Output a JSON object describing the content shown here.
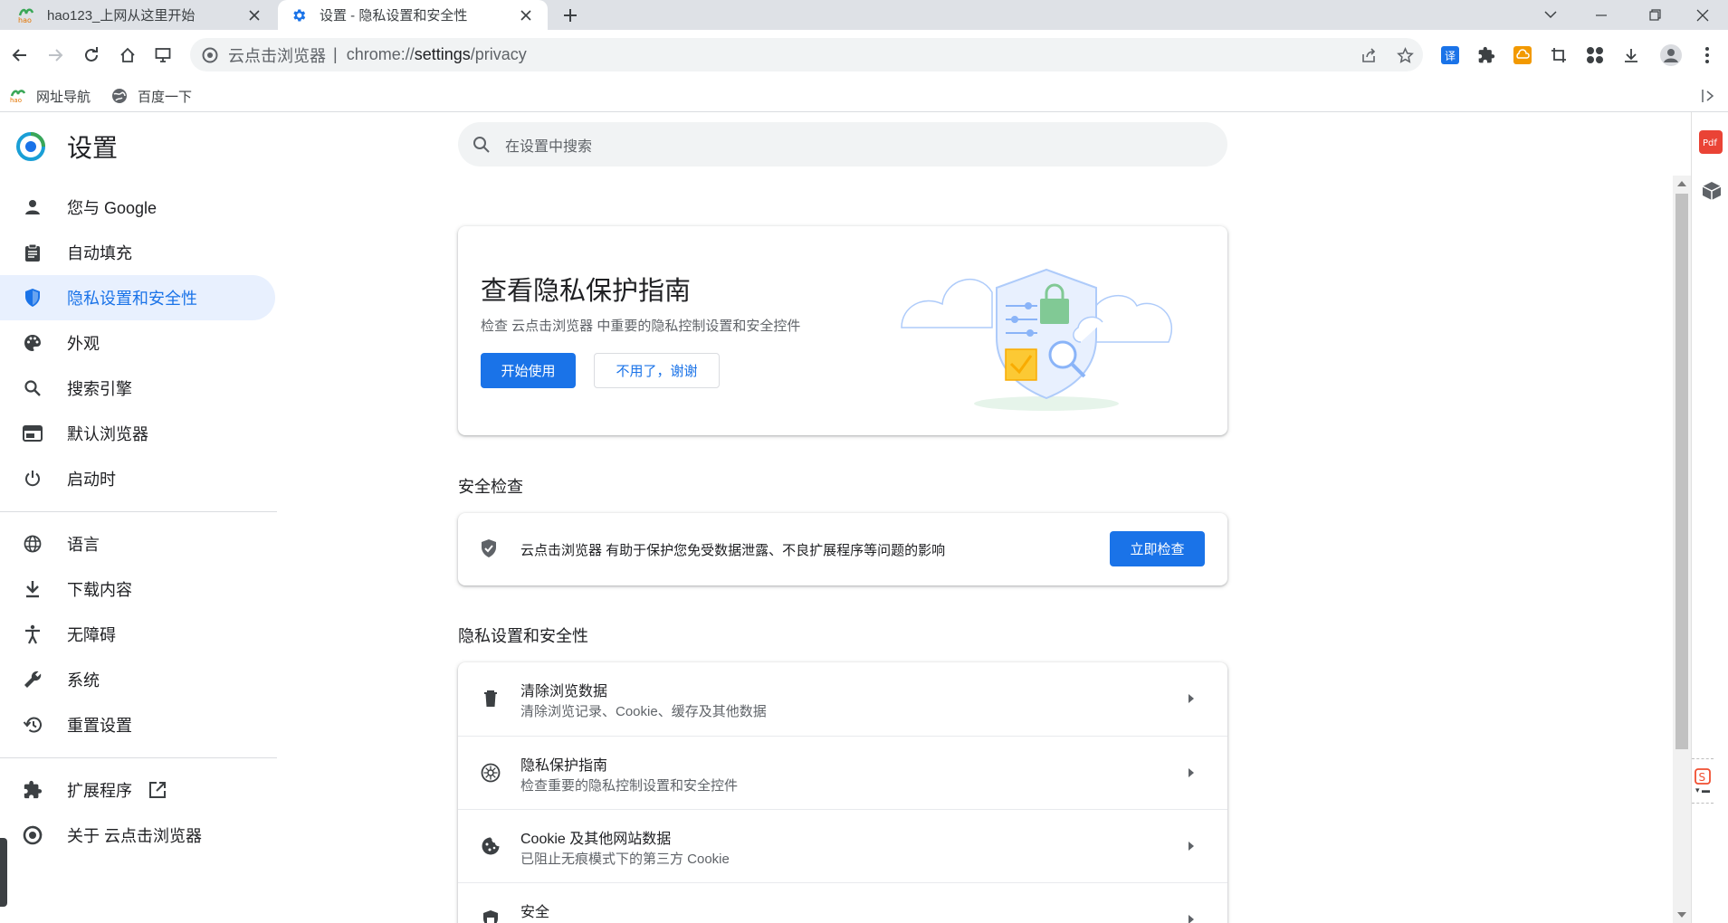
{
  "tabs": [
    {
      "title": "hao123_上网从这里开始",
      "icon": "hao123-icon"
    },
    {
      "title": "设置 - 隐私设置和安全性",
      "icon": "gear-icon"
    }
  ],
  "omnibox": {
    "site": "云点击浏览器",
    "separator": "|",
    "url_scheme": "chrome://",
    "url_host": "settings",
    "url_path": "/privacy"
  },
  "bookmarks": [
    {
      "label": "网址导航",
      "icon": "hao-icon"
    },
    {
      "label": "百度一下",
      "icon": "globe-icon"
    }
  ],
  "settings": {
    "title": "设置",
    "search_placeholder": "在设置中搜索"
  },
  "nav": {
    "items": [
      {
        "label": "您与 Google",
        "icon": "person-icon"
      },
      {
        "label": "自动填充",
        "icon": "clipboard-icon"
      },
      {
        "label": "隐私设置和安全性",
        "icon": "shield-icon",
        "selected": true
      },
      {
        "label": "外观",
        "icon": "palette-icon"
      },
      {
        "label": "搜索引擎",
        "icon": "search-icon"
      },
      {
        "label": "默认浏览器",
        "icon": "browser-icon"
      },
      {
        "label": "启动时",
        "icon": "power-icon"
      },
      {
        "label": "语言",
        "icon": "globe-icon"
      },
      {
        "label": "下载内容",
        "icon": "download-icon"
      },
      {
        "label": "无障碍",
        "icon": "accessibility-icon"
      },
      {
        "label": "系统",
        "icon": "wrench-icon"
      },
      {
        "label": "重置设置",
        "icon": "history-icon"
      },
      {
        "label": "扩展程序",
        "icon": "puzzle-icon"
      },
      {
        "label": "关于 云点击浏览器",
        "icon": "browser-logo-icon"
      }
    ]
  },
  "guide": {
    "title": "查看隐私保护指南",
    "subtitle": "检查 云点击浏览器 中重要的隐私控制设置和安全控件",
    "start_button": "开始使用",
    "dismiss_button": "不用了，谢谢"
  },
  "safety_check": {
    "heading": "安全检查",
    "text": "云点击浏览器 有助于保护您免受数据泄露、不良扩展程序等问题的影响",
    "button": "立即检查"
  },
  "privacy": {
    "heading": "隐私设置和安全性",
    "rows": [
      {
        "title": "清除浏览数据",
        "subtitle": "清除浏览记录、Cookie、缓存及其他数据",
        "icon": "trash-icon"
      },
      {
        "title": "隐私保护指南",
        "subtitle": "检查重要的隐私控制设置和安全控件",
        "icon": "compass-icon"
      },
      {
        "title": "Cookie 及其他网站数据",
        "subtitle": "已阻止无痕模式下的第三方 Cookie",
        "icon": "cookie-icon"
      },
      {
        "title": "安全",
        "subtitle": "",
        "icon": "shield-lock-icon"
      }
    ]
  },
  "colors": {
    "accent": "#1a73e8",
    "selected_bg": "#e8f0fe",
    "tabstrip": "#dee1e6"
  }
}
